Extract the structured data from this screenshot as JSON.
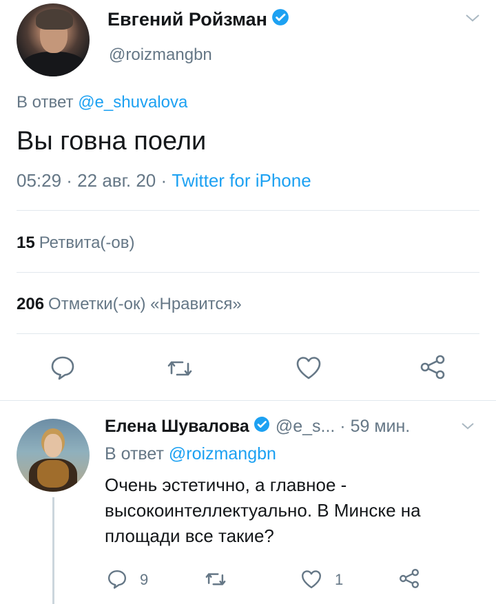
{
  "main_tweet": {
    "display_name": "Евгений Ройзман",
    "handle": "@roizmangbn",
    "reply_prefix": "В ответ",
    "reply_mention": "@e_shuvalova",
    "text": "Вы говна поели",
    "time": "05:29 · 22 авг. 20 · ",
    "source": "Twitter for iPhone",
    "retweets_count": "15",
    "retweets_label": "Ретвита(-ов)",
    "likes_count": "206",
    "likes_label": "Отметки(-ок) «Нравится»",
    "icons": [
      "reply-icon",
      "retweet-icon",
      "like-icon",
      "share-icon"
    ]
  },
  "reply_tweet": {
    "display_name": "Елена Шувалова",
    "handle_time": "@e_s... · 59 мин.",
    "reply_prefix": "В ответ",
    "reply_mention": "@roizmangbn",
    "text": "Очень эстетично, а главное - высокоинтеллектуально. В Минске на площади все такие?",
    "reply_count": "9",
    "retweet_count": "",
    "like_count": "1",
    "icons": [
      "reply-icon",
      "retweet-icon",
      "like-icon",
      "share-icon"
    ]
  },
  "colors": {
    "accent": "#1da1f2",
    "secondary_text": "#657786",
    "primary_text": "#14171a",
    "divider": "#e1e8ed"
  }
}
